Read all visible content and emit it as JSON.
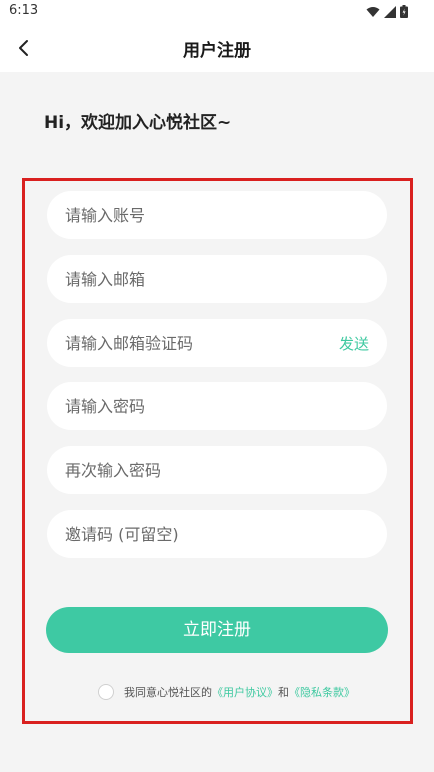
{
  "status_bar": {
    "time": "6:13"
  },
  "header": {
    "title": "用户注册"
  },
  "greeting": "Hi，欢迎加入心悦社区~",
  "form": {
    "account_placeholder": "请输入账号",
    "email_placeholder": "请输入邮箱",
    "code_placeholder": "请输入邮箱验证码",
    "send_label": "发送",
    "password_placeholder": "请输入密码",
    "confirm_placeholder": "再次输入密码",
    "invite_placeholder": "邀请码 (可留空)",
    "submit_label": "立即注册"
  },
  "agreement": {
    "prefix": "我同意心悦社区的",
    "user_agreement": "《用户协议》",
    "and": "和",
    "privacy_policy": "《隐私条款》",
    "checked": false
  },
  "colors": {
    "accent": "#3ec9a3",
    "highlight_border": "#d9201f",
    "background": "#f4f4f4"
  },
  "icons": [
    "back-arrow-icon",
    "wifi-icon",
    "signal-icon",
    "battery-icon"
  ]
}
